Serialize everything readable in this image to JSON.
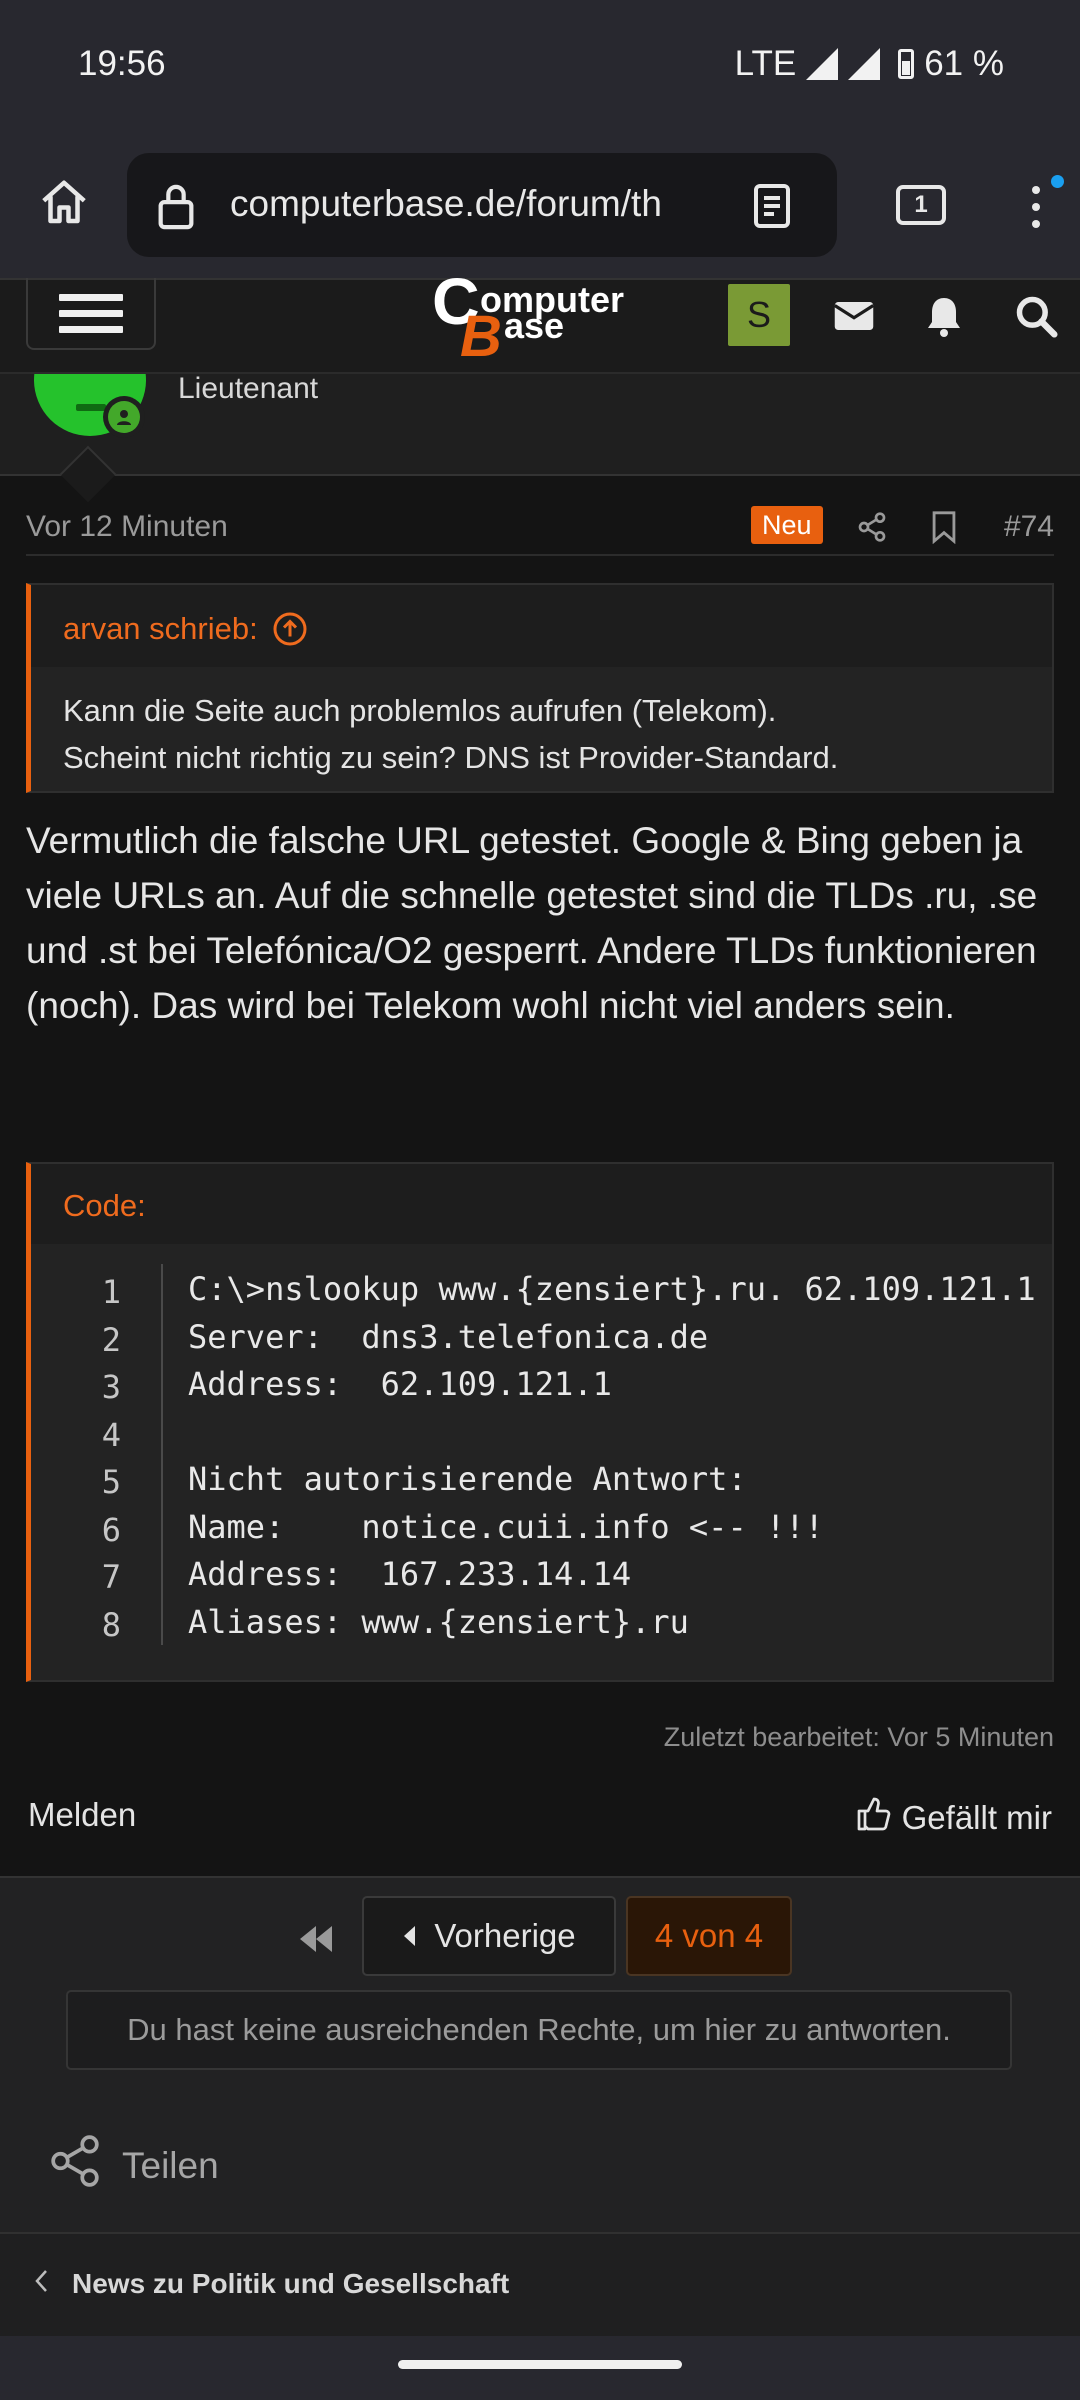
{
  "status_bar": {
    "time": "19:56",
    "network": "LTE",
    "battery": "61 %"
  },
  "browser": {
    "url": "computerbase.de/forum/th",
    "tab_count": "1"
  },
  "site": {
    "logo_line1": "omputer",
    "logo_line2": "ase",
    "logo_c": "C",
    "logo_b": "B",
    "user_initial": "S"
  },
  "post_author": {
    "title": "Lieutenant"
  },
  "post": {
    "date": "Vor 12 Minuten",
    "badge": "Neu",
    "number": "#74",
    "quote_author": "arvan schrieb:",
    "quote_lines": [
      "Kann die Seite auch problemlos aufrufen (Telekom).",
      "Scheint nicht richtig zu sein? DNS ist Provider-Standard."
    ],
    "body": "Vermutlich die falsche URL getestet. Google & Bing geben ja viele URLs an. Auf die schnelle getestet sind die TLDs .ru, .se und .st bei Telefónica/O2 gesperrt. Andere TLDs funktionieren (noch). Das wird bei Telekom wohl nicht viel anders sein.",
    "code_label": "Code:",
    "code_lines": [
      {
        "n": "1",
        "t": "C:\\>nslookup www.{zensiert}.ru. 62.109.121.1"
      },
      {
        "n": "2",
        "t": "Server:  dns3.telefonica.de"
      },
      {
        "n": "3",
        "t": "Address:  62.109.121.1"
      },
      {
        "n": "4",
        "t": ""
      },
      {
        "n": "5",
        "t": "Nicht autorisierende Antwort:"
      },
      {
        "n": "6",
        "t": "Name:    notice.cuii.info <-- !!!"
      },
      {
        "n": "7",
        "t": "Address:  167.233.14.14"
      },
      {
        "n": "8",
        "t": "Aliases: www.{zensiert}.ru"
      }
    ],
    "edited": "Zuletzt bearbeitet: Vor 5 Minuten",
    "report": "Melden",
    "like": "Gefällt mir"
  },
  "pagination": {
    "prev": "Vorherige",
    "current": "4 von 4"
  },
  "no_rights": "Du hast keine ausreichenden Rechte, um hier zu antworten.",
  "share": "Teilen",
  "breadcrumb": "News zu Politik und Gesellschaft",
  "colors": {
    "accent": "#e8600f",
    "avatar_green": "#25c22c",
    "user_badge": "#7a9a35"
  }
}
